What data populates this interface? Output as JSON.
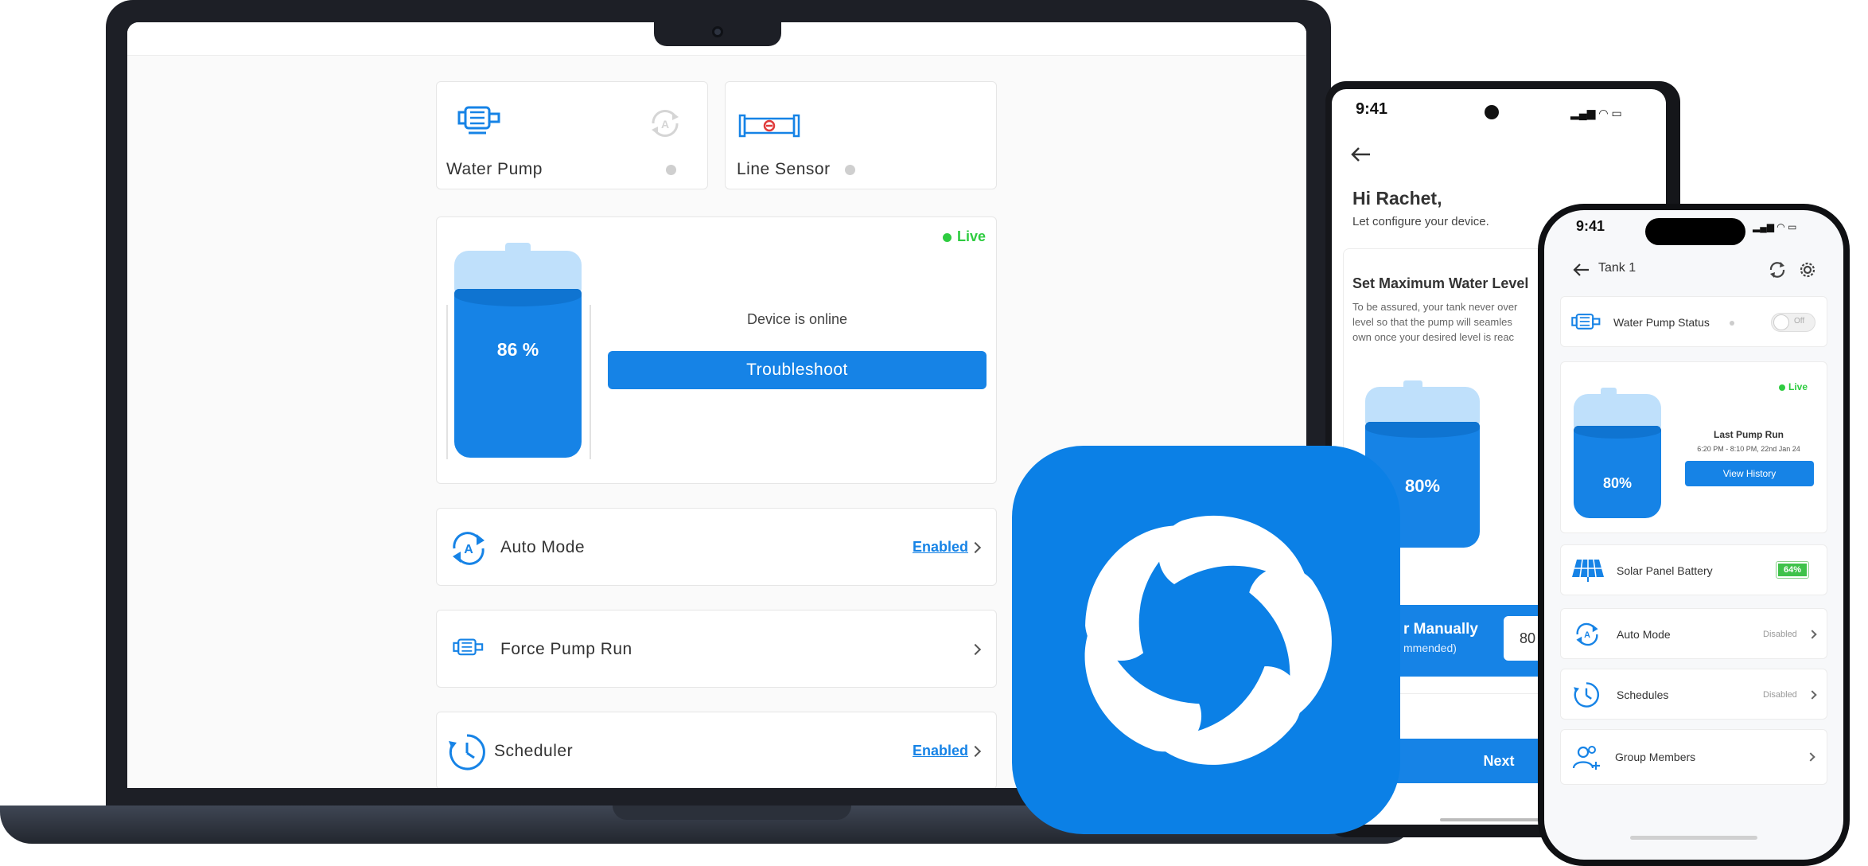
{
  "laptop": {
    "water_pump": {
      "label": "Water Pump"
    },
    "line_sensor": {
      "label": "Line Sensor"
    },
    "tank": {
      "live": "Live",
      "level": "86 %",
      "status": "Device is online",
      "troubleshoot": "Troubleshoot",
      "fill_percent": 86
    },
    "auto_mode": {
      "label": "Auto Mode",
      "value": "Enabled"
    },
    "force_pump": {
      "label": "Force Pump Run"
    },
    "scheduler": {
      "label": "Scheduler",
      "value": "Enabled"
    }
  },
  "phone_back": {
    "time": "9:41",
    "greeting": "Hi Rachet,",
    "subtitle": "Let configure your device.",
    "section_title": "Set Maximum Water Level",
    "desc_line1": "To be assured, your tank never over",
    "desc_line2": "level so that the pump will seamles",
    "desc_line3": "own once your desired level is reac",
    "tank_level": "80%",
    "manual_line1": "r Manually",
    "manual_line2": "mmended)",
    "manual_value": "80",
    "next": "Next"
  },
  "phone_front": {
    "time": "9:41",
    "title": "Tank 1",
    "pump_status": {
      "label": "Water Pump Status",
      "toggle": "Off"
    },
    "tank": {
      "live": "Live",
      "level": "80%",
      "last_run_label": "Last Pump Run",
      "last_run_time": "6:20 PM - 8:10 PM, 22nd Jan 24",
      "view_history": "View History"
    },
    "solar": {
      "label": "Solar Panel Battery",
      "value": "64%"
    },
    "auto_mode": {
      "label": "Auto Mode",
      "value": "Disabled"
    },
    "schedules": {
      "label": "Schedules",
      "value": "Disabled"
    },
    "group_members": {
      "label": "Group Members"
    }
  },
  "colors": {
    "accent": "#1683e6",
    "live": "#2ecc40",
    "dark": "#1d1f26"
  }
}
